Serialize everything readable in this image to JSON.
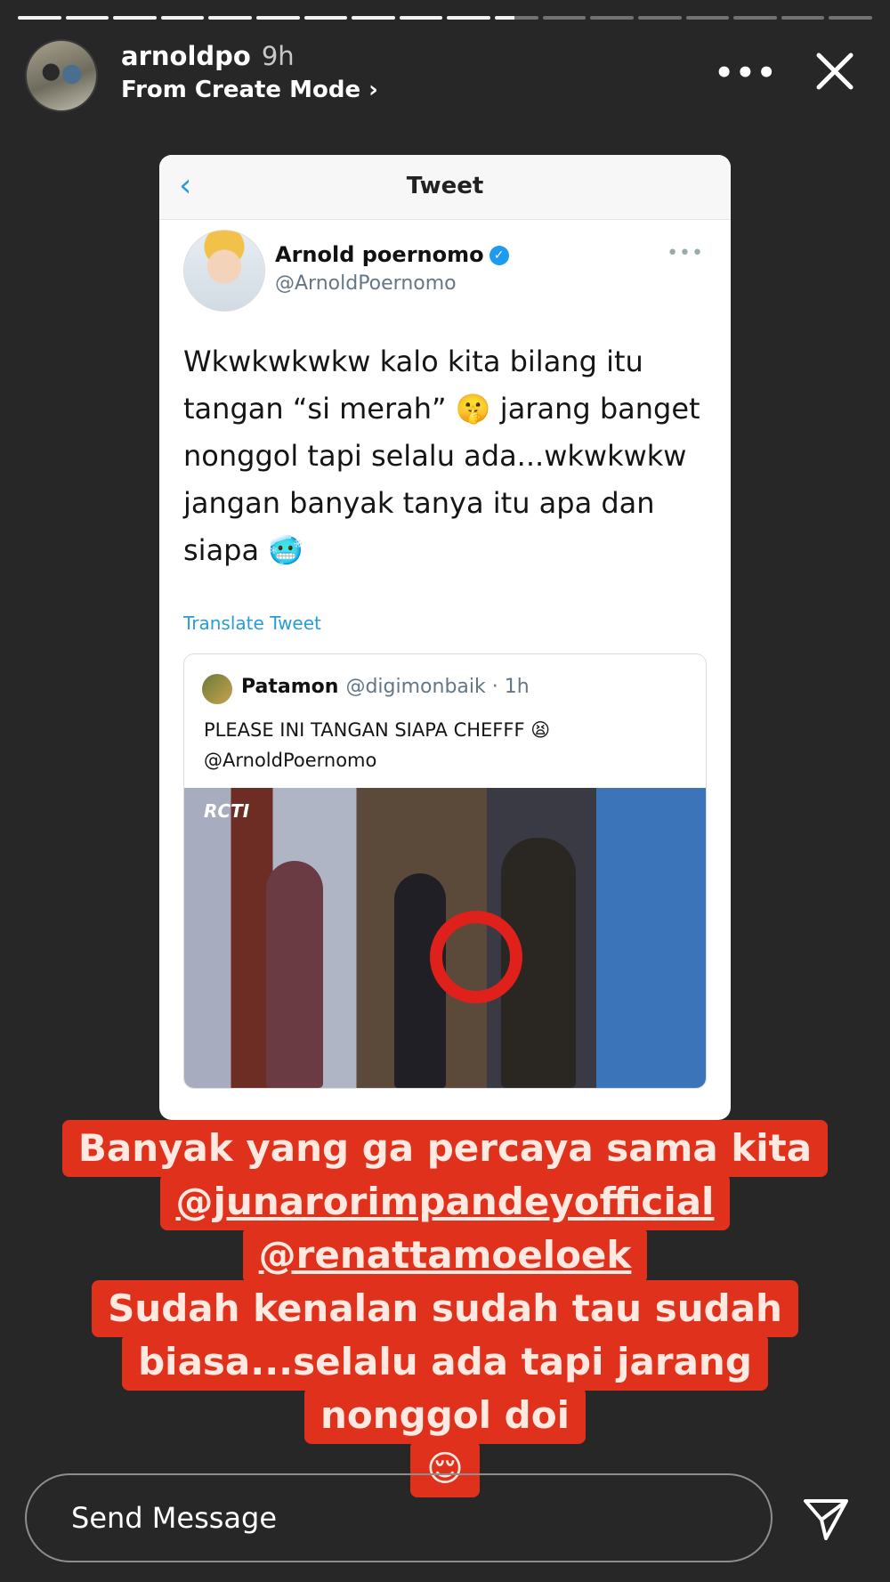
{
  "story": {
    "segments_total": 18,
    "segments_done": 10,
    "active_segment_progress": 0.45
  },
  "header": {
    "username": "arnoldpo",
    "time_ago": "9h",
    "subtitle": "From Create Mode ›"
  },
  "tweet": {
    "screen_title": "Tweet",
    "back_icon": "chevron-left-icon",
    "author_name": "Arnold poernomo",
    "author_handle": "@ArnoldPoernomo",
    "more": "•••",
    "text_lines": [
      "Wkwkwkwkw kalo kita bilang itu",
      "tangan “si merah” 🤫 jarang banget",
      "nonggol tapi selalu ada...wkwkwkw",
      "jangan banyak tanya itu apa dan",
      "siapa 🥶"
    ],
    "translate": "Translate Tweet",
    "quote": {
      "name": "Patamon",
      "handle": "@digimonbaik · 1h",
      "text_line1": "PLEASE INI TANGAN SIAPA CHEFFF 😫",
      "text_line2": "@ArnoldPoernomo",
      "media_logo": "RCTI"
    }
  },
  "caption": {
    "line1": "Banyak yang ga percaya sama kita",
    "line2": "@junarorimpandeyofficial",
    "line3": "@renattamoeloek",
    "line4": "Sudah kenalan sudah tau sudah",
    "line5": "biasa...selalu ada tapi jarang",
    "line6": "nonggol doi",
    "emoji": "😌"
  },
  "composer": {
    "placeholder": "Send Message"
  },
  "colors": {
    "background": "#272727",
    "caption_bg": "#e0311d",
    "link_blue": "#2a9bd6",
    "verified": "#1d9bf0"
  }
}
